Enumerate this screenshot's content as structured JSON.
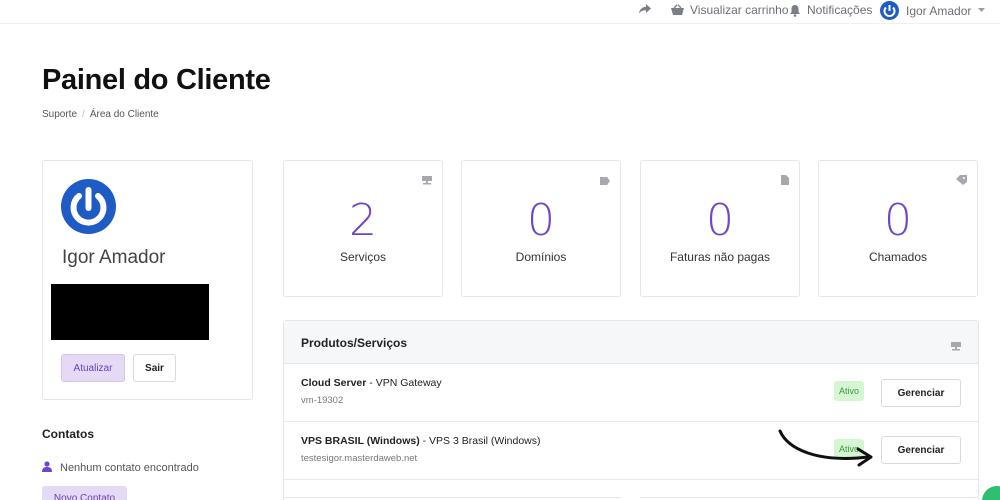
{
  "topbar": {
    "cart_label": "Visualizar carrinho",
    "notifications_label": "Notificações",
    "user_label": "Igor Amador"
  },
  "page": {
    "title": "Painel do Cliente",
    "breadcrumb": [
      "Suporte",
      "Área do Cliente"
    ]
  },
  "profile": {
    "name": "Igor Amador",
    "update_label": "Atualizar",
    "logout_label": "Sair"
  },
  "contacts": {
    "title": "Contatos",
    "empty_text": "Nenhum contato encontrado",
    "new_label": "Novo Contato"
  },
  "stats": [
    {
      "value": "2",
      "label": "Serviços",
      "icon": "server-icon"
    },
    {
      "value": "0",
      "label": "Domínios",
      "icon": "tag-icon"
    },
    {
      "value": "0",
      "label": "Faturas não pagas",
      "icon": "document-icon"
    },
    {
      "value": "0",
      "label": "Chamados",
      "icon": "ticket-icon"
    }
  ],
  "products": {
    "title": "Produtos/Serviços",
    "items": [
      {
        "name": "Cloud Server",
        "plan": " - VPN Gateway",
        "host": "vm-19302",
        "status": "Ativo",
        "action": "Gerenciar"
      },
      {
        "name": "VPS BRASIL (Windows)",
        "plan": " - VPS 3 Brasil (Windows)",
        "host": "testesigor.masterdaweb.net",
        "status": "Ativo",
        "action": "Gerenciar"
      }
    ]
  },
  "colors": {
    "accent": "#6f45c9",
    "brand_blue": "#1f5bc4",
    "active_green": "#3a9a36"
  }
}
